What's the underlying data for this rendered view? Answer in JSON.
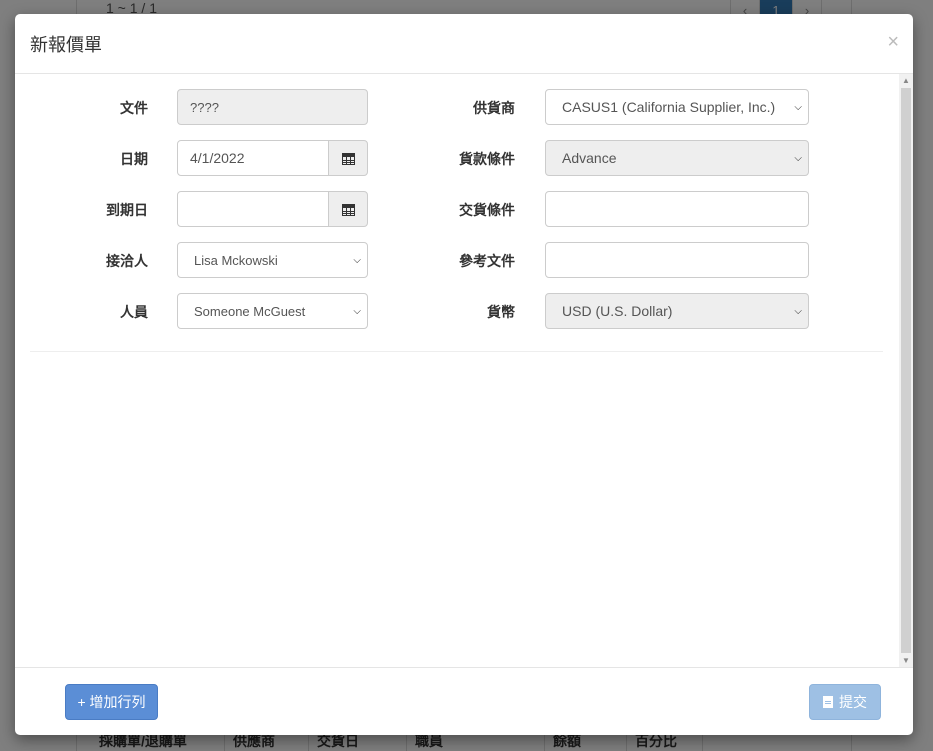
{
  "background": {
    "pagination_info": "1 ~ 1 / 1",
    "pager": {
      "prev": "‹",
      "current": "1",
      "next": "›"
    },
    "table_headers": [
      "採購單/退購單",
      "供應商",
      "交貨日",
      "職員",
      "餘額",
      "百分比"
    ]
  },
  "modal": {
    "title": "新報價單",
    "close": "×",
    "fields": {
      "document": {
        "label": "文件",
        "value": "????"
      },
      "date": {
        "label": "日期",
        "value": "4/1/2022"
      },
      "due_date": {
        "label": "到期日",
        "value": ""
      },
      "contact": {
        "label": "接洽人",
        "value": "Lisa Mckowski"
      },
      "staff": {
        "label": "人員",
        "value": "Someone McGuest"
      },
      "supplier": {
        "label": "供貨商",
        "value": "CASUS1 (California Supplier, Inc.)"
      },
      "payment_terms": {
        "label": "貨款條件",
        "value": "Advance"
      },
      "delivery_terms": {
        "label": "交貨條件",
        "value": ""
      },
      "reference": {
        "label": "參考文件",
        "value": ""
      },
      "currency": {
        "label": "貨幣",
        "value": "USD (U.S. Dollar)"
      }
    },
    "footer": {
      "add_row": "+ 增加行列",
      "submit": "提交"
    }
  },
  "colors": {
    "primary": "#5b8ed6",
    "primary_disabled": "#9ec0e4",
    "readonly_bg": "#eeeeee"
  }
}
